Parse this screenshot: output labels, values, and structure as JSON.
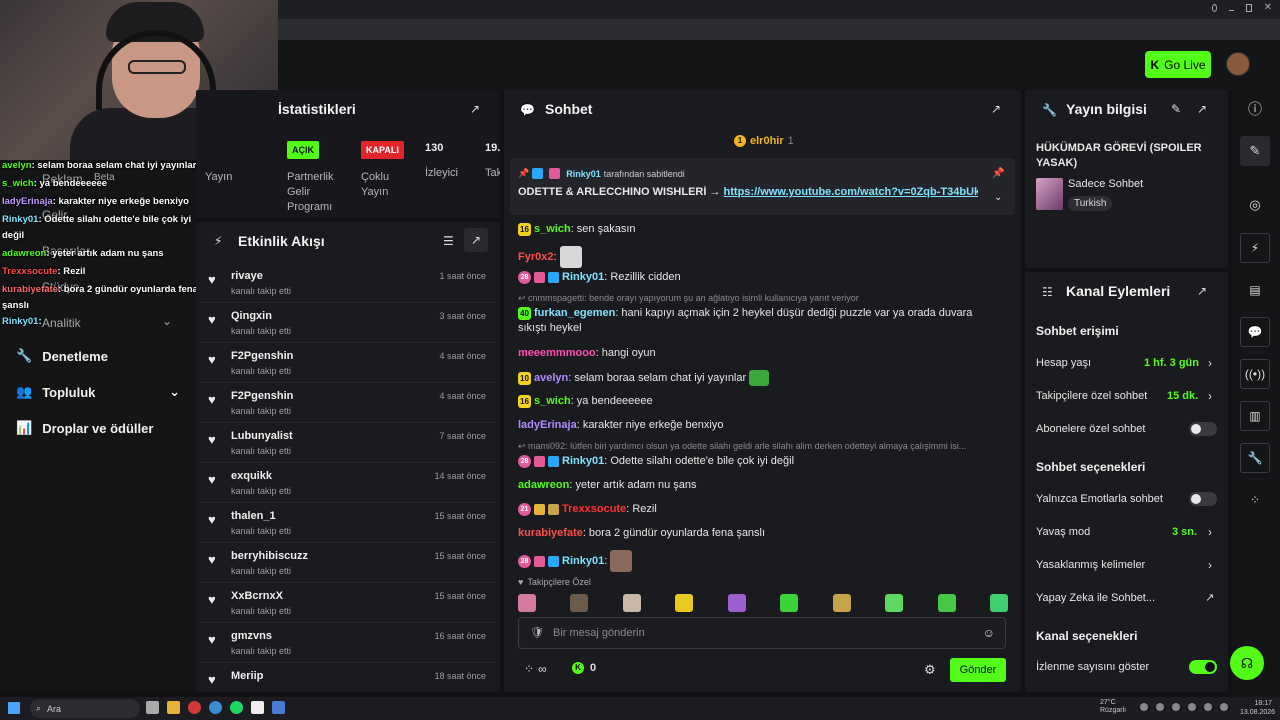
{
  "header": {
    "go_live_label": "Go Live"
  },
  "sidebar": {
    "ghost_items": [
      "Reklam",
      "Beta",
      "Gelir",
      "Başarılar",
      "Stüdyo",
      "Analitik"
    ],
    "items": [
      {
        "label": "Denetleme"
      },
      {
        "label": "Topluluk"
      },
      {
        "label": "Droplar ve ödüller"
      }
    ]
  },
  "overlay_chat": [
    {
      "user": "avelyn",
      "text": ": selam boraa selam chat iyi yayınlar"
    },
    {
      "user": "s_wich",
      "text": ": ya bendeeeeee"
    },
    {
      "user": "ladyErinaja",
      "text": ": karakter niye erkeğe benxiyo"
    },
    {
      "user": "Rinky01",
      "text": ": Odette silahı odette'e bile çok iyi"
    },
    {
      "user": "",
      "text": "değil"
    },
    {
      "user": "adawreon",
      "text": ": yeter artık adam nu şans"
    },
    {
      "user": "Trexxsocute",
      "text": ": Rezil"
    },
    {
      "user": "kurabiyefate",
      "text": ": bora 2 gündür oyunlarda fena"
    },
    {
      "user": "",
      "text": "şanslı"
    },
    {
      "user": "Rinky01",
      "text": ":"
    }
  ],
  "stats": {
    "title": "İstatistikleri",
    "col0": "Yayın",
    "badge1": "AÇIK",
    "label1": "Partnerlik Gelir Programı",
    "badge2": "KAPALI",
    "label2": "Çoklu Yayın",
    "viewers": "130",
    "viewers_label": "İzleyici",
    "followers": "19.",
    "followers_label": "Tak"
  },
  "activity": {
    "title": "Etkinlik Akışı",
    "items": [
      {
        "name": "rivaye",
        "sub": "kanalı takip etti",
        "time": "1 saat önce"
      },
      {
        "name": "Qingxin",
        "sub": "kanalı takip etti",
        "time": "3 saat önce"
      },
      {
        "name": "F2Pgenshin",
        "sub": "kanalı takip etti",
        "time": "4 saat önce"
      },
      {
        "name": "F2Pgenshin",
        "sub": "kanalı takip etti",
        "time": "4 saat önce"
      },
      {
        "name": "Lubunyalist",
        "sub": "kanalı takip etti",
        "time": "7 saat önce"
      },
      {
        "name": "exquikk",
        "sub": "kanalı takip etti",
        "time": "14 saat önce"
      },
      {
        "name": "thalen_1",
        "sub": "kanalı takip etti",
        "time": "15 saat önce"
      },
      {
        "name": "berryhibiscuzz",
        "sub": "kanalı takip etti",
        "time": "15 saat önce"
      },
      {
        "name": "XxBcrnxX",
        "sub": "kanalı takip etti",
        "time": "15 saat önce"
      },
      {
        "name": "gmzvns",
        "sub": "kanalı takip etti",
        "time": "16 saat önce"
      },
      {
        "name": "Meriip",
        "sub": "",
        "time": "18 saat önce"
      }
    ]
  },
  "chat": {
    "title": "Sohbet",
    "top_gifter": "elr0hir",
    "top_gifter_count": "1",
    "pinned_by_user": "Rinky01",
    "pinned_by_suffix": "tarafından sabitlendi",
    "pinned_text": "ODETTE & ARLECCHINO WISHLERİ →",
    "pinned_link": "https://www.youtube.com/watch?v=0Zqb-T34bUk",
    "messages": [
      {
        "level": "16",
        "user": "s_wich",
        "text": ": sen şakasın"
      },
      {
        "user": "Fyr0x2",
        "text": ":"
      },
      {
        "level": "28",
        "user": "Rinky01",
        "text": ": Rezillik cidden"
      },
      {
        "reply": "cnmmspagetti: bende orayı yapıyorum şu an ağlatıyo isimli kullanıcıya yanıt veriyor"
      },
      {
        "level": "40",
        "user": "furkan_egemen",
        "text": ": hani kapıyı açmak için 2 heykel düşür dediği puzzle var ya orada duvara",
        "text2": "sıkıştı heykel"
      },
      {
        "user": "meeemmmooo",
        "text": ": hangi oyun"
      },
      {
        "level": "10",
        "user": "avelyn",
        "text": ": selam boraa selam chat iyi yayınlar"
      },
      {
        "level": "16",
        "user": "s_wich",
        "text": ": ya bendeeeeee"
      },
      {
        "user": "ladyErinaja",
        "text": ": karakter niye erkeğe benxiyo"
      },
      {
        "reply": "mami092: lütfen biri yardımcı olsun ya odette silahı geldi arle silahı alim derken odetteyi almaya çalışimmi isi..."
      },
      {
        "level": "28",
        "user": "Rinky01",
        "text": ": Odette silahı odette'e bile çok iyi değil"
      },
      {
        "user": "adawreon",
        "text": ": yeter artık adam nu şans"
      },
      {
        "level": "21",
        "user": "Trexxsocute",
        "text": ": Rezil"
      },
      {
        "user": "kurabiyefate",
        "text": ": bora 2 gündür oyunlarda fena şanslı"
      },
      {
        "level": "28",
        "user": "Rinky01",
        "text": ":"
      }
    ],
    "followers_only": "Takipçilere Özel",
    "input_placeholder": "Bir mesaj gönderin",
    "infinity": "∞",
    "points": "0",
    "send_label": "Gönder"
  },
  "stream_info": {
    "title": "Yayın bilgisi",
    "stream_title": "HÜKÜMDAR GÖREVİ (SPOILER YASAK)",
    "category": "Sadece Sohbet",
    "language": "Turkish"
  },
  "channel_actions": {
    "title": "Kanal Eylemleri",
    "chat_access_heading": "Sohbet erişimi",
    "account_age_label": "Hesap yaşı",
    "account_age_value": "1 hf. 3 gün",
    "followers_chat_label": "Takipçilere özel sohbet",
    "followers_chat_value": "15 dk.",
    "subs_chat_label": "Abonelere özel sohbet",
    "chat_options_heading": "Sohbet seçenekleri",
    "emote_only_label": "Yalnızca Emotlarla sohbet",
    "slow_mode_label": "Yavaş mod",
    "slow_mode_value": "3 sn.",
    "banned_words_label": "Yasaklanmış kelimeler",
    "ai_chat_label": "Yapay Zeka ile Sohbet...",
    "channel_options_heading": "Kanal seçenekleri",
    "show_viewers_label": "İzlenme sayısını göster"
  },
  "taskbar": {
    "search_label": "Ara",
    "weather": "27°C",
    "weather_sub": "Rüzgarlı",
    "time": "18:17",
    "date": "13.08.2026"
  },
  "colors": {
    "accent": "#53fc18",
    "panel": "#1a1b1e",
    "bg": "#111214"
  }
}
